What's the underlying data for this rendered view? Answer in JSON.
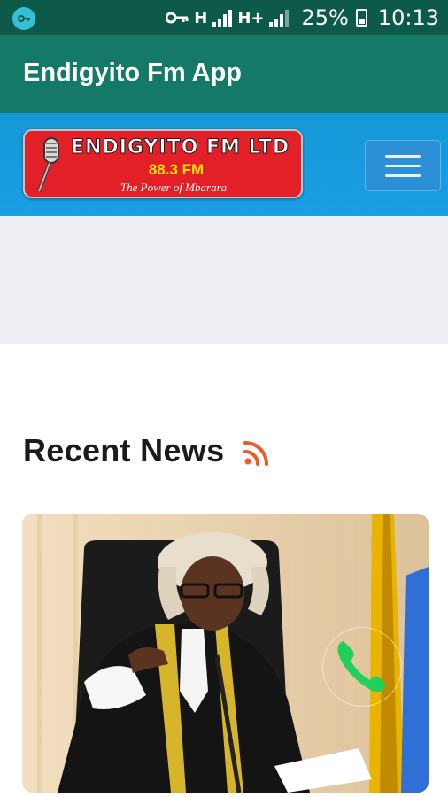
{
  "status_bar": {
    "vpn_icon": "key-circle-icon",
    "key_icon": "vpn-key-icon",
    "network_1": "H",
    "network_2": "H+",
    "battery_percent": "25%",
    "time": "10:13"
  },
  "app_bar": {
    "title": "Endigyito Fm App"
  },
  "header": {
    "logo": {
      "name": "ENDIGYITO FM LTD",
      "frequency": "88.3 FM",
      "tagline": "The Power of Mbarara"
    },
    "menu_icon": "hamburger-menu-icon"
  },
  "news": {
    "heading": "Recent News",
    "heading_icon": "rss-feed-icon",
    "card_image": "news-photo-speaker-in-wig"
  },
  "fab": {
    "icon": "phone-call-icon"
  },
  "colors": {
    "status_bar": "#0e5a4a",
    "app_bar": "#147a67",
    "header": "#1598d8",
    "logo_red": "#e32028",
    "rss_orange": "#f05a28",
    "call_green": "#1fd05a"
  }
}
